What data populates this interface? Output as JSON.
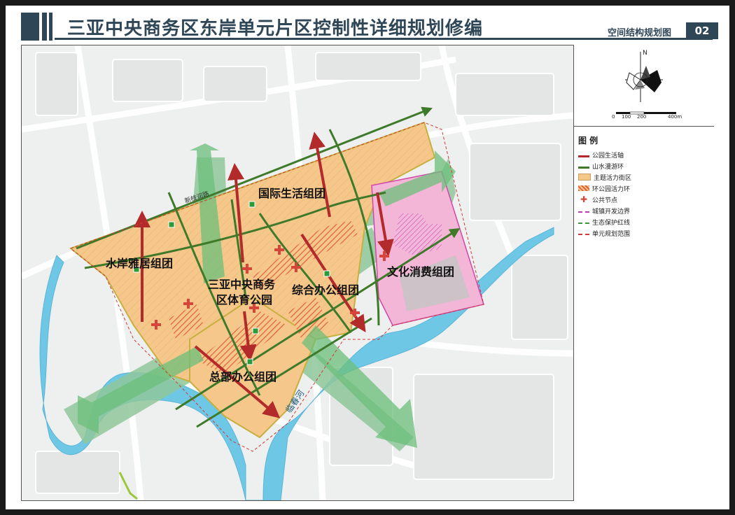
{
  "header": {
    "title": "三亚中央商务区东岸单元片区控制性详细规划修编",
    "subtitle": "空间结构规划图",
    "page_number": "02"
  },
  "compass": {
    "north_label": "N"
  },
  "scale_bar": {
    "ticks": [
      "0",
      "100",
      "200",
      "400m"
    ]
  },
  "legend": {
    "title": "图  例",
    "items": [
      {
        "label": "公园生活轴",
        "icon": "red-arrow-line",
        "color": "#b22a2a"
      },
      {
        "label": "山水漫游环",
        "icon": "green-line",
        "color": "#3f7a2a"
      },
      {
        "label": "主题活力街区",
        "icon": "orange-fill",
        "color": "#f5c78a"
      },
      {
        "label": "环公园活力环",
        "icon": "red-hatch",
        "color": "#e0603a"
      },
      {
        "label": "公共节点",
        "icon": "red-cross",
        "color": "#d6453a"
      },
      {
        "label": "城镇开发边界",
        "icon": "magenta-dashed-line",
        "color": "#c03ab0"
      },
      {
        "label": "生态保护红线",
        "icon": "green-dashed-line",
        "color": "#3a9a3a"
      },
      {
        "label": "单元规划范围",
        "icon": "red-dashed-line",
        "color": "#d03a3a"
      }
    ]
  },
  "map": {
    "zone_labels": [
      "国际生活组团",
      "水岸雅居组团",
      "三亚中央商务",
      "区体育公园",
      "综合办公组团",
      "文化消费组团",
      "总部办公组团"
    ],
    "road_label": "新枝润路",
    "river_label": "临春河"
  }
}
